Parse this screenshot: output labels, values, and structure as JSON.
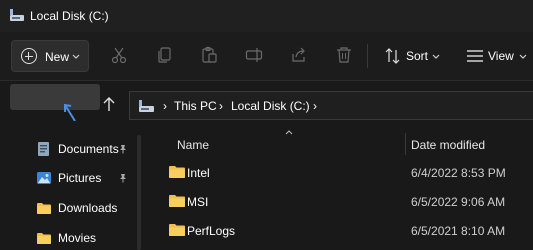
{
  "window": {
    "title": "Local Disk (C:)"
  },
  "toolbar": {
    "new_label": "New",
    "sort_label": "Sort",
    "view_label": "View",
    "icons": [
      "cut-icon",
      "copy-icon",
      "paste-icon",
      "rename-icon",
      "share-icon",
      "delete-icon"
    ]
  },
  "address": {
    "segments": [
      "This PC",
      "Local Disk (C:)"
    ]
  },
  "sidebar": {
    "items": [
      {
        "label": "Documents",
        "pinned": true
      },
      {
        "label": "Pictures",
        "pinned": true
      },
      {
        "label": "Downloads",
        "pinned": false
      },
      {
        "label": "Movies",
        "pinned": false
      }
    ]
  },
  "columns": {
    "name": "Name",
    "date": "Date modified"
  },
  "files": [
    {
      "name": "Intel",
      "date": "6/4/2022 8:53 PM"
    },
    {
      "name": "MSI",
      "date": "6/5/2022 9:06 AM"
    },
    {
      "name": "PerfLogs",
      "date": "6/5/2021 8:10 AM"
    }
  ],
  "colors": {
    "folder": "#f2c04a",
    "accent": "#4a90e2",
    "background": "#191919"
  }
}
